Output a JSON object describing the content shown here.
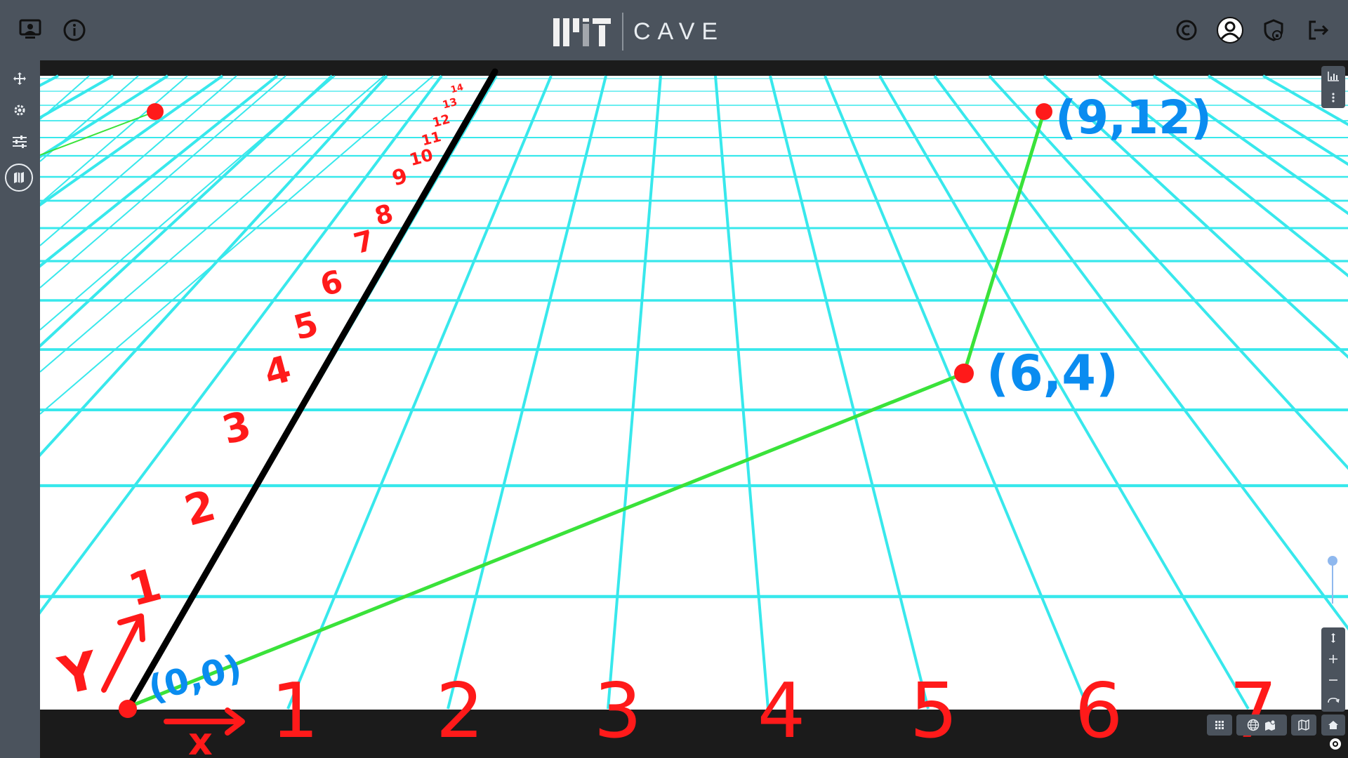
{
  "app": {
    "wordmark": "CAVE",
    "logo": "MIT"
  },
  "topbar": {
    "left_icons": [
      "presenter-icon",
      "info-icon"
    ],
    "right_icons": [
      "copyright-icon",
      "account-icon",
      "shield-lock-icon",
      "logout-icon"
    ]
  },
  "sidebar": {
    "items": [
      {
        "name": "move-icon"
      },
      {
        "name": "settings-icon"
      },
      {
        "name": "sliders-icon"
      },
      {
        "name": "map-icon",
        "active": true
      }
    ]
  },
  "annotations": {
    "x_axis_labels": [
      "1",
      "2",
      "3",
      "4",
      "5",
      "6",
      "7"
    ],
    "y_axis_labels": [
      "1",
      "2",
      "3",
      "4",
      "5",
      "6",
      "7",
      "8",
      "9",
      "10",
      "11",
      "12",
      "13",
      "14"
    ],
    "x_arrow_label": "x",
    "y_arrow_label": "Y",
    "points": [
      {
        "label": "(0,0)",
        "x": 0,
        "y": 0
      },
      {
        "label": "(6,4)",
        "x": 6,
        "y": 4
      },
      {
        "label": "(9,12)",
        "x": 9,
        "y": 12
      }
    ]
  },
  "colors": {
    "grid": "#38e8ec",
    "axis_numbers": "#ff1a1a",
    "point_labels": "#0a8cf0",
    "path": "#3ae23a",
    "axis_line": "#000000",
    "topbar": "#4b535d"
  },
  "map_controls": {
    "right_top": [
      "chart-icon",
      "more-vert-icon"
    ],
    "right_bottom": [
      "pitch-icon",
      "zoom-in-icon",
      "zoom-out-icon",
      "rotate-icon",
      "home-icon"
    ],
    "bottom": [
      "grid-icon",
      "globe-icon",
      "map-marker-icon",
      "map-icon"
    ]
  }
}
